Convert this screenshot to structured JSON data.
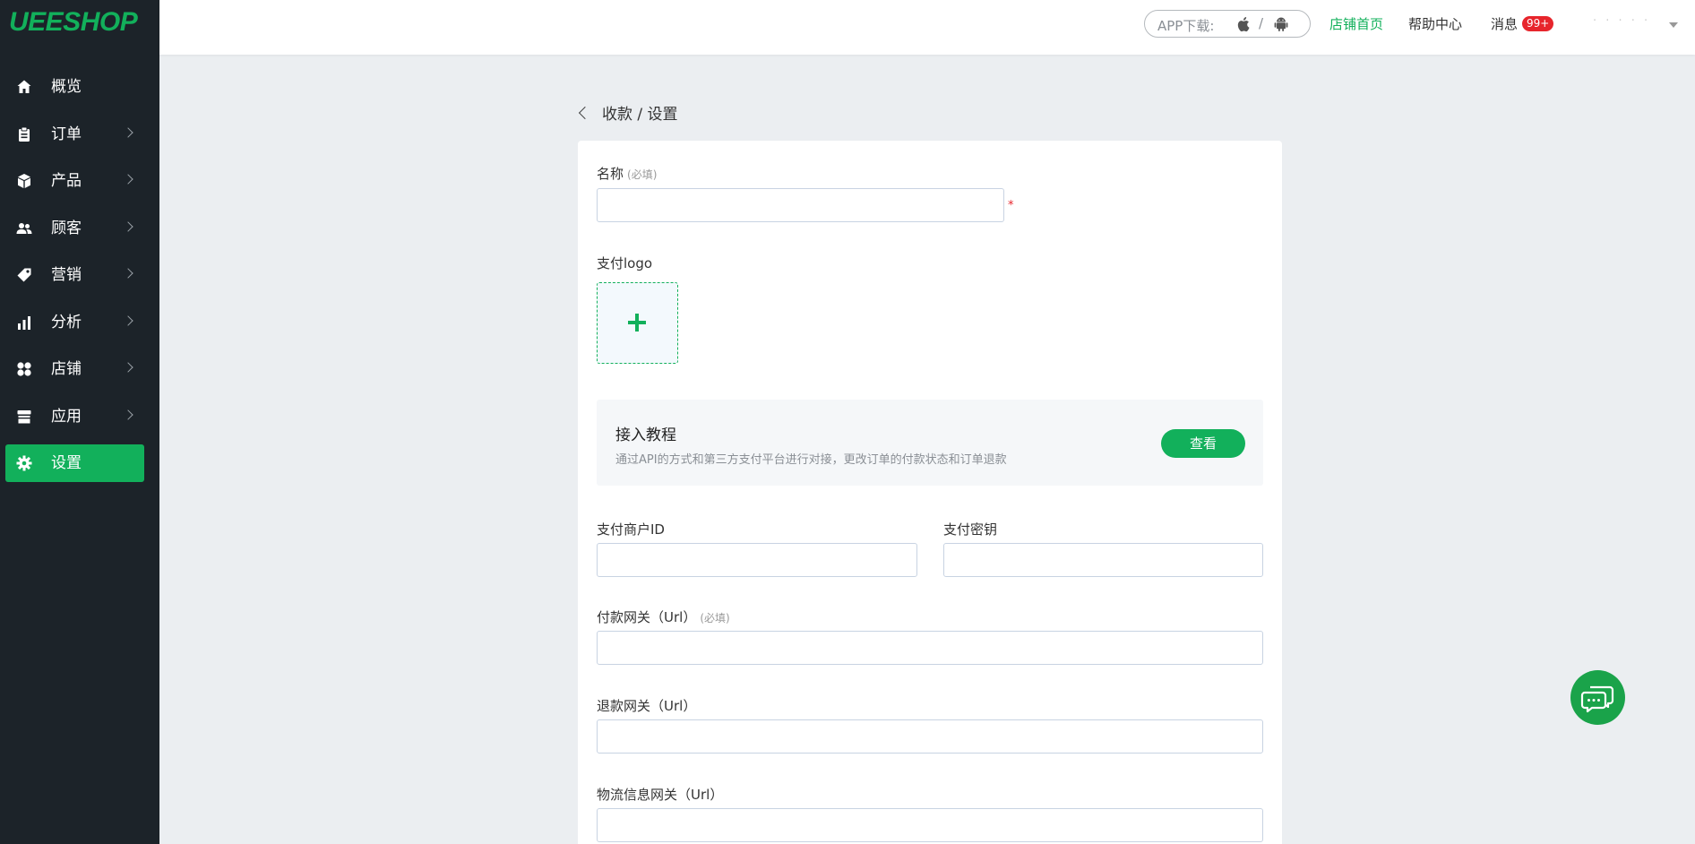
{
  "logo": "UEESHOP",
  "sidebar": {
    "items": [
      {
        "label": "概览",
        "icon": "home-icon",
        "chevron": false,
        "active": false
      },
      {
        "label": "订单",
        "icon": "clipboard-icon",
        "chevron": true,
        "active": false
      },
      {
        "label": "产品",
        "icon": "box-icon",
        "chevron": true,
        "active": false
      },
      {
        "label": "顾客",
        "icon": "users-icon",
        "chevron": true,
        "active": false
      },
      {
        "label": "营销",
        "icon": "tag-icon",
        "chevron": true,
        "active": false
      },
      {
        "label": "分析",
        "icon": "bar-chart-icon",
        "chevron": true,
        "active": false
      },
      {
        "label": "店铺",
        "icon": "grid-icon",
        "chevron": true,
        "active": false
      },
      {
        "label": "应用",
        "icon": "store-icon",
        "chevron": true,
        "active": false
      },
      {
        "label": "设置",
        "icon": "gear-icon",
        "chevron": false,
        "active": true
      }
    ]
  },
  "header": {
    "app_download": "APP下载:",
    "slash": "/",
    "store_home": "店铺首页",
    "help_center": "帮助中心",
    "messages": "消息",
    "messages_badge": "99+",
    "user_name": "· ·  ·  ·   ·"
  },
  "breadcrumb": "收款 / 设置",
  "form": {
    "name_label": "名称",
    "name_required": "(必填)",
    "name_value": "",
    "required_mark": "*",
    "logo_label": "支付logo",
    "tutorial_title": "接入教程",
    "tutorial_desc": "通过API的方式和第三方支付平台进行对接，更改订单的付款状态和订单退款",
    "view_button": "查看",
    "merchant_id_label": "支付商户ID",
    "merchant_id_value": "",
    "secret_label": "支付密钥",
    "secret_value": "",
    "pay_gateway_label": "付款网关（Url）",
    "pay_gateway_required": "(必填)",
    "pay_gateway_value": "",
    "refund_gateway_label": "退款网关（Url）",
    "refund_gateway_value": "",
    "logistics_gateway_label": "物流信息网关（Url）",
    "logistics_gateway_value": ""
  },
  "colors": {
    "accent": "#12b05b",
    "sidebar_bg": "#1c2329",
    "page_bg": "#ebeef1",
    "badge": "#e7252c"
  }
}
